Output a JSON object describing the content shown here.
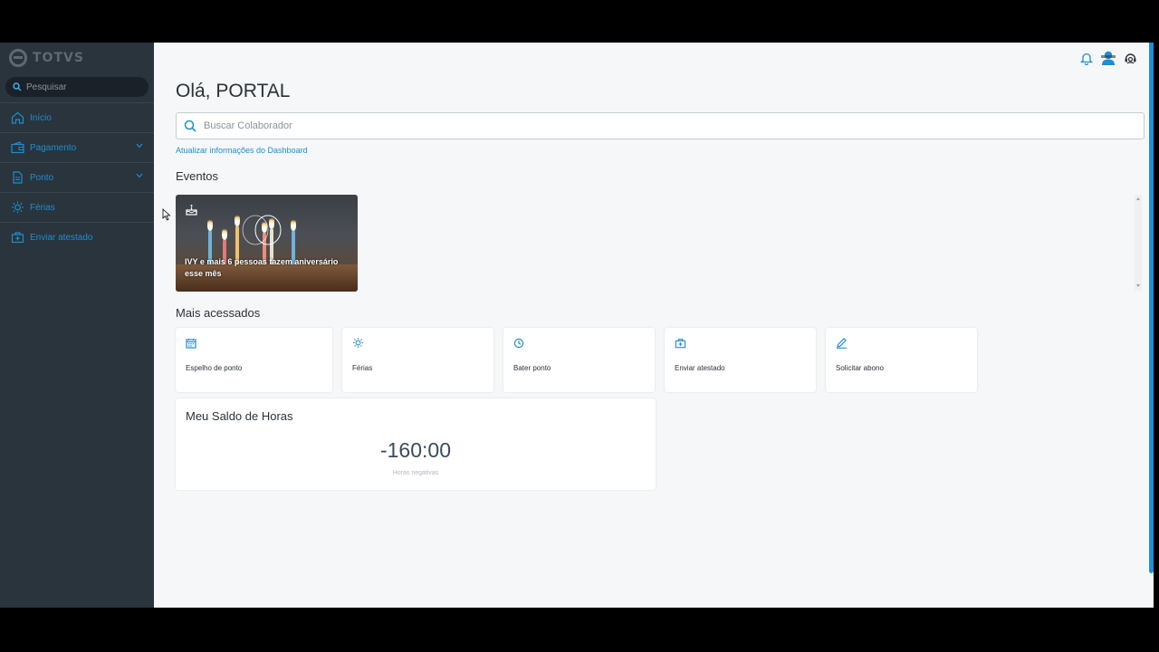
{
  "brand": {
    "name": "TOTVS"
  },
  "sidebar": {
    "search_placeholder": "Pesquisar",
    "items": [
      {
        "label": "Início",
        "icon": "home-icon",
        "has_submenu": false
      },
      {
        "label": "Pagamento",
        "icon": "wallet-icon",
        "has_submenu": true
      },
      {
        "label": "Ponto",
        "icon": "document-icon",
        "has_submenu": true
      },
      {
        "label": "Férias",
        "icon": "sun-icon",
        "has_submenu": false
      },
      {
        "label": "Enviar atestado",
        "icon": "medical-kit-icon",
        "has_submenu": false
      }
    ]
  },
  "header": {
    "icons": [
      "bell-icon",
      "avatar-icon",
      "support-icon"
    ]
  },
  "main": {
    "greeting": "Olá, PORTAL",
    "colab_search_placeholder": "Buscar Colaborador",
    "refresh_link": "Atualizar informações do Dashboard",
    "events": {
      "title": "Eventos",
      "cards": [
        {
          "text": "IVY e mais 6 pessoas fazem aniversário esse mês",
          "icon": "cake-icon"
        }
      ]
    },
    "most_accessed": {
      "title": "Mais acessados",
      "items": [
        {
          "label": "Espelho de ponto",
          "icon": "calendar-icon"
        },
        {
          "label": "Férias",
          "icon": "sun-icon"
        },
        {
          "label": "Bater ponto",
          "icon": "clock-icon"
        },
        {
          "label": "Enviar atestado",
          "icon": "medical-kit-icon"
        },
        {
          "label": "Solicitar abono",
          "icon": "pencil-icon"
        }
      ]
    },
    "saldo": {
      "title": "Meu Saldo de Horas",
      "value": "-160:00",
      "subtitle": "Horas negativas"
    }
  },
  "colors": {
    "sidebar_bg": "#29343d",
    "accent": "#1e8ed0",
    "main_bg": "#f6f7f8"
  }
}
